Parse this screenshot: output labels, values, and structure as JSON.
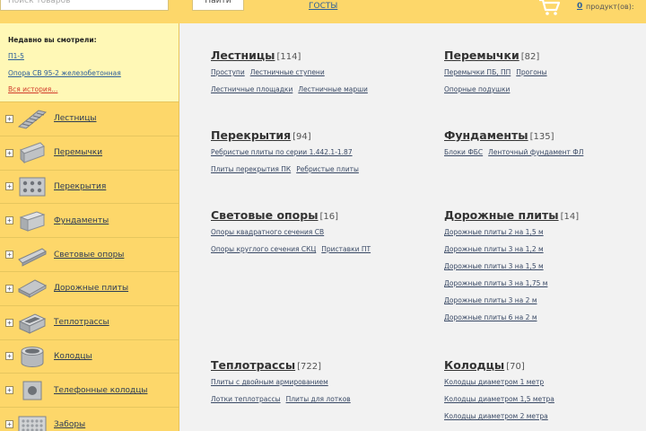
{
  "header": {
    "search_placeholder": "Поиск товаров",
    "search_button": "Найти",
    "gosty_link": "ГОСТЫ",
    "cart_count": "0",
    "cart_label": "продукт(ов):",
    "cart_icon": "shopping-cart-icon"
  },
  "recent": {
    "title": "Недавно вы смотрели:",
    "items": [
      "П1-5",
      "Опора СВ 95-2 железобетонная"
    ],
    "all_history": "Вся история..."
  },
  "sidebar": {
    "items": [
      {
        "label": "Лестницы",
        "icon": "stairs-thumb"
      },
      {
        "label": "Перемычки",
        "icon": "lintel-thumb"
      },
      {
        "label": "Перекрытия",
        "icon": "slab-thumb"
      },
      {
        "label": "Фундаменты",
        "icon": "foundation-block-thumb"
      },
      {
        "label": "Световые опоры",
        "icon": "light-pole-thumb"
      },
      {
        "label": "Дорожные плиты",
        "icon": "road-slab-thumb"
      },
      {
        "label": "Теплотрассы",
        "icon": "heating-channel-thumb"
      },
      {
        "label": "Колодцы",
        "icon": "well-ring-thumb"
      },
      {
        "label": "Телефонные колодцы",
        "icon": "phone-well-thumb"
      },
      {
        "label": "Заборы",
        "icon": "fence-panel-thumb"
      }
    ]
  },
  "categories": [
    {
      "title": "Лестницы",
      "count": "[114]",
      "rows": [
        [
          "Проступи",
          "Лестничные ступени"
        ],
        [
          "Лестничные площадки",
          "Лестничные марши"
        ]
      ]
    },
    {
      "title": "Перемычки",
      "count": "[82]",
      "rows": [
        [
          "Перемычки ПБ, ПП",
          "Прогоны"
        ],
        [
          "Опорные подушки"
        ]
      ]
    },
    {
      "title": "Перекрытия",
      "count": "[94]",
      "rows": [
        [
          "Ребристые плиты по серии 1.442.1-1.87"
        ],
        [
          "Плиты перекрытия ПК",
          "Ребристые плиты"
        ]
      ]
    },
    {
      "title": "Фундаменты",
      "count": "[135]",
      "rows": [
        [
          "Блоки ФБС",
          "Ленточный фундамент ФЛ"
        ]
      ]
    },
    {
      "title": "Световые опоры",
      "count": "[16]",
      "rows": [
        [
          "Опоры квадратного сечения СВ"
        ],
        [
          "Опоры круглого сечения СКЦ",
          "Приставки ПТ"
        ]
      ]
    },
    {
      "title": "Дорожные плиты",
      "count": "[14]",
      "rows": [
        [
          "Дорожные плиты 2 на 1,5 м"
        ],
        [
          "Дорожные плиты 3 на 1,2 м"
        ],
        [
          "Дорожные плиты 3 на 1,5 м"
        ],
        [
          "Дорожные плиты 3 на 1,75 м"
        ],
        [
          "Дорожные плиты 3 на 2 м"
        ],
        [
          "Дорожные плиты 6 на 2 м"
        ]
      ]
    },
    {
      "title": "Теплотрассы",
      "count": "[722]",
      "rows": [
        [
          "Плиты с двойным армированием"
        ],
        [
          "Лотки теплотрассы",
          "Плиты для лотков"
        ]
      ]
    },
    {
      "title": "Колодцы",
      "count": "[70]",
      "rows": [
        [
          "Колодцы диаметром 1 метр"
        ],
        [
          "Колодцы диаметром 1,5 метра"
        ],
        [
          "Колодцы диаметром 2 метра"
        ]
      ]
    }
  ]
}
